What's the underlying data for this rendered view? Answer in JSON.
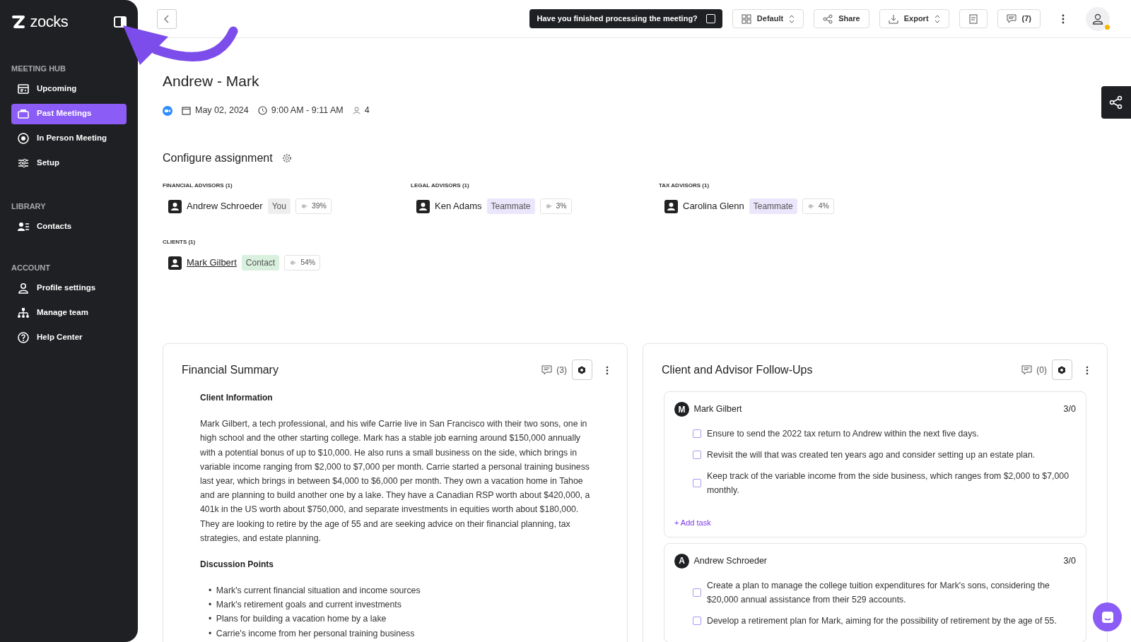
{
  "sidebar": {
    "logo": "zocks",
    "sections": [
      {
        "title": "MEETING HUB",
        "items": [
          {
            "label": "Upcoming",
            "selected": false
          },
          {
            "label": "Past Meetings",
            "selected": true
          },
          {
            "label": "In Person Meeting",
            "selected": false
          },
          {
            "label": "Setup",
            "selected": false
          }
        ]
      },
      {
        "title": "LIBRARY",
        "items": [
          {
            "label": "Contacts",
            "selected": false
          }
        ]
      },
      {
        "title": "ACCOUNT",
        "items": [
          {
            "label": "Profile settings",
            "selected": false
          },
          {
            "label": "Manage team",
            "selected": false
          },
          {
            "label": "Help Center",
            "selected": false
          }
        ]
      }
    ]
  },
  "topbar": {
    "prompt": {
      "text": "Have you finished processing the meeting?",
      "checked": false
    },
    "buttons": [
      {
        "kind": "layout",
        "label": "Default"
      },
      {
        "kind": "share",
        "label": "Share"
      },
      {
        "kind": "export",
        "label": "Export"
      },
      {
        "kind": "notes"
      },
      {
        "kind": "comments",
        "label": "(7)"
      }
    ],
    "avatar": {
      "online": true
    }
  },
  "meeting": {
    "title": "Andrew - Mark",
    "date": "May 02, 2024",
    "time": "9:00 AM - 9:11 AM",
    "attendees": "4"
  },
  "assignment": {
    "title": "Configure assignment",
    "groups": [
      {
        "title": "FINANCIAL ADVISORS (1)",
        "people": [
          {
            "name": "Andrew Schroeder",
            "kind": "self",
            "tag": "You",
            "share": "39%"
          }
        ]
      },
      {
        "title": "LEGAL ADVISORS (1)",
        "people": [
          {
            "name": "Ken Adams",
            "kind": "teammate",
            "tag": "Teammate",
            "share": "3%"
          }
        ]
      },
      {
        "title": "TAX ADVISORS (1)",
        "people": [
          {
            "name": "Carolina Glenn",
            "kind": "teammate",
            "tag": "Teammate",
            "share": "4%"
          }
        ]
      },
      {
        "title": "CLIENTS (1)",
        "people": [
          {
            "name": "Mark Gilbert",
            "kind": "contact",
            "tag": "Contact",
            "share": "54%"
          }
        ]
      }
    ]
  },
  "summary": {
    "title": "Financial Summary",
    "comments": "(3)",
    "sections": [
      {
        "heading": "Client Information",
        "paragraph": "Mark Gilbert, a tech professional, and his wife Carrie live in San Francisco with their two sons, one in high school and the other starting college. Mark has a stable job earning around $150,000 annually with a potential bonus of up to $10,000. He also runs a small business on the side, which brings in variable income ranging from $2,000 to $7,000 per month. Carrie started a personal training business last year, which brings in between $4,000 to $6,000 per month. They own a vacation home in Tahoe and are planning to build another one by a lake. They have a Canadian RSP worth about $420,000, a 401k in the US worth about $750,000, and separate investments in equities worth about $180,000. They are looking to retire by the age of 55 and are seeking advice on their financial planning, tax strategies, and estate planning."
      },
      {
        "heading": "Discussion Points",
        "marker": "•",
        "bullets": [
          "Mark's current financial situation and income sources",
          "Mark's retirement goals and current investments",
          "Plans for building a vacation home by a lake",
          "Carrie's income from her personal training business"
        ]
      }
    ]
  },
  "followups": {
    "title": "Client and Advisor Follow-Ups",
    "comments": "(0)",
    "groups": [
      {
        "initial": "M",
        "name": "Mark Gilbert",
        "count": "3/0",
        "add_task": "+ Add task",
        "tasks": [
          {
            "text": "Ensure to send the 2022 tax return to Andrew within the next five days.",
            "checked": false
          },
          {
            "text": "Revisit the will that was created ten years ago and consider setting up an estate plan.",
            "checked": false
          },
          {
            "text": "Keep track of the variable income from the side business, which ranges from $2,000 to $7,000 monthly.",
            "checked": false
          }
        ]
      },
      {
        "initial": "A",
        "name": "Andrew Schroeder",
        "count": "3/0",
        "tasks": [
          {
            "text": "Create a plan to manage the college tuition expenditures for Mark's sons, considering the $20,000 annual assistance from their 529 accounts.",
            "checked": false
          },
          {
            "text": "Develop a retirement plan for Mark, aiming for the possibility of retirement by the age of 55.",
            "checked": false
          }
        ]
      }
    ]
  }
}
